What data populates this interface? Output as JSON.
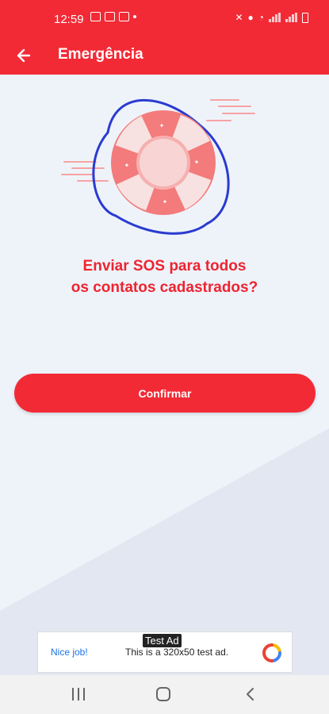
{
  "status_bar": {
    "time": "12:59"
  },
  "app_bar": {
    "title": "Emergência",
    "back_icon": "arrow-left-icon"
  },
  "main": {
    "question_line1": "Enviar SOS para todos",
    "question_line2": "os contatos cadastrados?",
    "confirm_label": "Confirmar"
  },
  "ad": {
    "badge": "Test Ad",
    "nice_job": "Nice job!",
    "body": "This is a 320x50 test ad."
  },
  "colors": {
    "primary": "#f22a35",
    "background": "#eef3fa",
    "ring": "#f37b7b",
    "orbit": "#2a3bd0"
  }
}
